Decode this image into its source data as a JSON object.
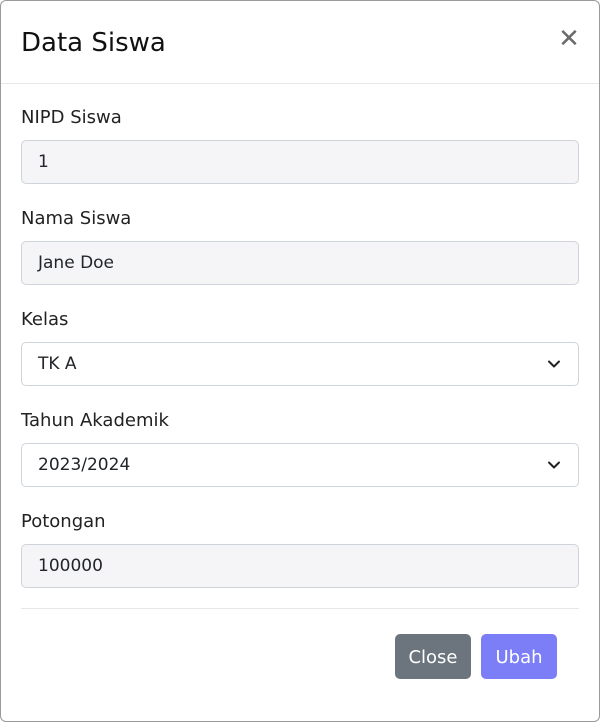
{
  "modal": {
    "title": "Data Siswa",
    "close_icon": "close-icon"
  },
  "form": {
    "nipd": {
      "label": "NIPD Siswa",
      "value": "1"
    },
    "nama": {
      "label": "Nama Siswa",
      "value": "Jane Doe"
    },
    "kelas": {
      "label": "Kelas",
      "value": "TK A"
    },
    "tahun": {
      "label": "Tahun Akademik",
      "value": "2023/2024"
    },
    "potongan": {
      "label": "Potongan",
      "value": "100000"
    }
  },
  "footer": {
    "close_label": "Close",
    "ubah_label": "Ubah"
  },
  "colors": {
    "close_button": "#6c757d",
    "ubah_button": "#7b7ef7"
  }
}
